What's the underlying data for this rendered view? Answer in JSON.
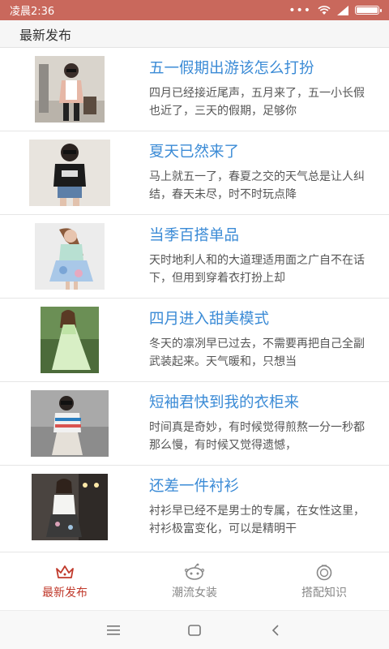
{
  "status_bar": {
    "time": "凌晨2:36",
    "dots": "•••"
  },
  "header": {
    "title": "最新发布"
  },
  "articles": [
    {
      "title": "五一假期出游该怎么打扮",
      "desc": "四月已经接近尾声，五月来了，五一小长假也近了，三天的假期，足够你"
    },
    {
      "title": "夏天已然来了",
      "desc": "马上就五一了，春夏之交的天气总是让人纠结，春天未尽，时不时玩点降"
    },
    {
      "title": "当季百搭单品",
      "desc": "天时地利人和的大道理适用面之广自不在话下，但用到穿着衣打扮上却"
    },
    {
      "title": "四月进入甜美模式",
      "desc": "冬天的凛冽早已过去，不需要再把自己全副武装起来。天气暖和，只想当"
    },
    {
      "title": "短袖君快到我的衣柜来",
      "desc": "时间真是奇妙，有时候觉得煎熬一分一秒都那么慢，有时候又觉得遗憾，"
    },
    {
      "title": "还差一件衬衫",
      "desc": "衬衫早已经不是男士的专属，在女性这里，衬衫极富变化，可以是精明干"
    }
  ],
  "tabs": [
    {
      "label": "最新发布",
      "icon": "crown-icon"
    },
    {
      "label": "潮流女装",
      "icon": "alien-face-icon"
    },
    {
      "label": "搭配知识",
      "icon": "ring-icon"
    }
  ],
  "colors": {
    "status_bar": "#c9685c",
    "title_blue": "#3b8bd6",
    "active_tab": "#c0392b"
  }
}
